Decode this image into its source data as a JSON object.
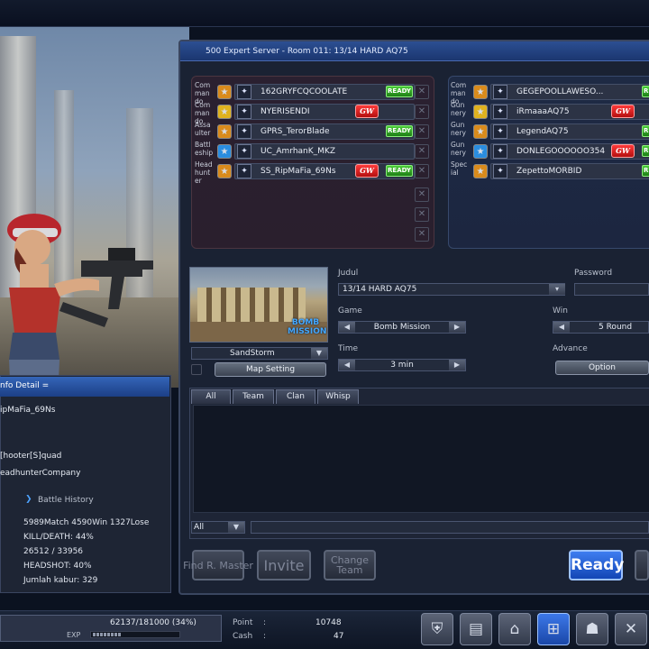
{
  "room": {
    "title": "500 Expert Server - Room 011: 13/14 HARD AQ75"
  },
  "colors": {
    "ready": "#2ea82a",
    "gw": "#e01b1b",
    "accent": "#2f5fb8"
  },
  "team_a": [
    {
      "cls": "Com man do",
      "name": "162GRYFCQCOOLATE",
      "status": "READY",
      "rank_icon": "rank-icon"
    },
    {
      "cls": "Com man do",
      "name": "NYERISENDI",
      "status": "GW",
      "rank_icon": "rank-icon"
    },
    {
      "cls": "Assa ulter",
      "name": "GPRS_TerorBlade",
      "status": "READY",
      "rank_icon": "rank-icon"
    },
    {
      "cls": "Battl eship",
      "name": "UC_AmrhanK_MKZ",
      "status": "",
      "rank_icon": "rank-icon"
    },
    {
      "cls": "Head hunt er",
      "name": "SS_RipMaFia_69Ns",
      "status": "GW READY",
      "rank_icon": "rank-icon"
    }
  ],
  "team_b": [
    {
      "cls": "Com man do",
      "name": "GEGEPOOLLAWESO...",
      "status": "READY"
    },
    {
      "cls": "Gun nery",
      "name": "iRmaaaAQ75",
      "status": "GW"
    },
    {
      "cls": "Gun nery",
      "name": "LegendAQ75",
      "status": "READY"
    },
    {
      "cls": "Gun nery",
      "name": "DONLEGOOOOOO354",
      "status": "GW READY"
    },
    {
      "cls": "Spec ial",
      "name": "ZepettoMORBID",
      "status": "READY"
    }
  ],
  "labels": {
    "ready": "READY",
    "gw": "GW",
    "empty_slot": "✕"
  },
  "map": {
    "name": "SandStorm",
    "tag": "BOMB MISSION",
    "setting_button": "Map Setting"
  },
  "settings": {
    "judul_label": "Judul",
    "judul_value": "13/14 HARD AQ75",
    "password_label": "Password",
    "game_label": "Game",
    "game_value": "Bomb Mission",
    "win_label": "Win",
    "win_value": "5 Round",
    "time_label": "Time",
    "time_value": "3 min",
    "advance_label": "Advance",
    "option_button": "Option"
  },
  "chat": {
    "tabs": [
      "All",
      "Team",
      "Clan",
      "Whisp"
    ],
    "channel": "All"
  },
  "buttons": {
    "find_master": "Find R. Master",
    "invite": "Invite",
    "change_team": "Change Team",
    "ready": "Ready"
  },
  "info": {
    "title": "nfo Detail =",
    "player_name": "ipMaFia_69Ns",
    "squad": "[hooter[S]quad",
    "company": "eadhunterCompany",
    "battle_history": "Battle History",
    "match_line": "5989Match 4590Win 1327Lose",
    "kd_line": "KILL/DEATH:  44%",
    "kd_value": "26512 / 33956",
    "headshot": "HEADSHOT:  40%",
    "kabur": "Jumlah kabur: 329"
  },
  "status": {
    "exp_text": "62137/181000 (34%)",
    "exp_label": "EXP",
    "exp_fraction": 0.34,
    "point_label": "Point",
    "point_sep": ":",
    "point_value": "10748",
    "cash_label": "Cash",
    "cash_sep": ":",
    "cash_value": "47"
  },
  "nav_icons": [
    "character-icon",
    "inventory-icon",
    "shop-icon",
    "cart-icon",
    "clan-icon",
    "settings-wrench-icon"
  ]
}
